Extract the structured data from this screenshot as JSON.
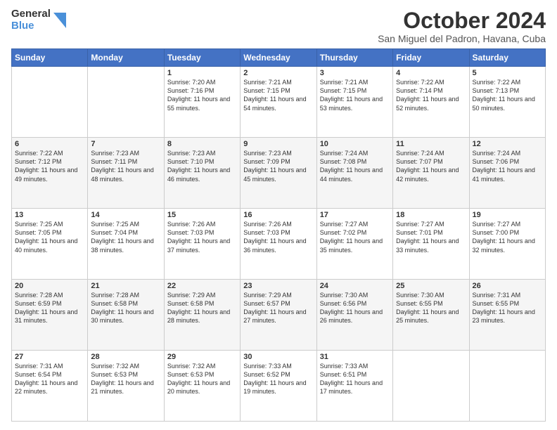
{
  "logo": {
    "line1": "General",
    "line2": "Blue"
  },
  "title": "October 2024",
  "location": "San Miguel del Padron, Havana, Cuba",
  "days_of_week": [
    "Sunday",
    "Monday",
    "Tuesday",
    "Wednesday",
    "Thursday",
    "Friday",
    "Saturday"
  ],
  "weeks": [
    [
      {
        "day": "",
        "sunrise": "",
        "sunset": "",
        "daylight": ""
      },
      {
        "day": "",
        "sunrise": "",
        "sunset": "",
        "daylight": ""
      },
      {
        "day": "1",
        "sunrise": "Sunrise: 7:20 AM",
        "sunset": "Sunset: 7:16 PM",
        "daylight": "Daylight: 11 hours and 55 minutes."
      },
      {
        "day": "2",
        "sunrise": "Sunrise: 7:21 AM",
        "sunset": "Sunset: 7:15 PM",
        "daylight": "Daylight: 11 hours and 54 minutes."
      },
      {
        "day": "3",
        "sunrise": "Sunrise: 7:21 AM",
        "sunset": "Sunset: 7:15 PM",
        "daylight": "Daylight: 11 hours and 53 minutes."
      },
      {
        "day": "4",
        "sunrise": "Sunrise: 7:22 AM",
        "sunset": "Sunset: 7:14 PM",
        "daylight": "Daylight: 11 hours and 52 minutes."
      },
      {
        "day": "5",
        "sunrise": "Sunrise: 7:22 AM",
        "sunset": "Sunset: 7:13 PM",
        "daylight": "Daylight: 11 hours and 50 minutes."
      }
    ],
    [
      {
        "day": "6",
        "sunrise": "Sunrise: 7:22 AM",
        "sunset": "Sunset: 7:12 PM",
        "daylight": "Daylight: 11 hours and 49 minutes."
      },
      {
        "day": "7",
        "sunrise": "Sunrise: 7:23 AM",
        "sunset": "Sunset: 7:11 PM",
        "daylight": "Daylight: 11 hours and 48 minutes."
      },
      {
        "day": "8",
        "sunrise": "Sunrise: 7:23 AM",
        "sunset": "Sunset: 7:10 PM",
        "daylight": "Daylight: 11 hours and 46 minutes."
      },
      {
        "day": "9",
        "sunrise": "Sunrise: 7:23 AM",
        "sunset": "Sunset: 7:09 PM",
        "daylight": "Daylight: 11 hours and 45 minutes."
      },
      {
        "day": "10",
        "sunrise": "Sunrise: 7:24 AM",
        "sunset": "Sunset: 7:08 PM",
        "daylight": "Daylight: 11 hours and 44 minutes."
      },
      {
        "day": "11",
        "sunrise": "Sunrise: 7:24 AM",
        "sunset": "Sunset: 7:07 PM",
        "daylight": "Daylight: 11 hours and 42 minutes."
      },
      {
        "day": "12",
        "sunrise": "Sunrise: 7:24 AM",
        "sunset": "Sunset: 7:06 PM",
        "daylight": "Daylight: 11 hours and 41 minutes."
      }
    ],
    [
      {
        "day": "13",
        "sunrise": "Sunrise: 7:25 AM",
        "sunset": "Sunset: 7:05 PM",
        "daylight": "Daylight: 11 hours and 40 minutes."
      },
      {
        "day": "14",
        "sunrise": "Sunrise: 7:25 AM",
        "sunset": "Sunset: 7:04 PM",
        "daylight": "Daylight: 11 hours and 38 minutes."
      },
      {
        "day": "15",
        "sunrise": "Sunrise: 7:26 AM",
        "sunset": "Sunset: 7:03 PM",
        "daylight": "Daylight: 11 hours and 37 minutes."
      },
      {
        "day": "16",
        "sunrise": "Sunrise: 7:26 AM",
        "sunset": "Sunset: 7:03 PM",
        "daylight": "Daylight: 11 hours and 36 minutes."
      },
      {
        "day": "17",
        "sunrise": "Sunrise: 7:27 AM",
        "sunset": "Sunset: 7:02 PM",
        "daylight": "Daylight: 11 hours and 35 minutes."
      },
      {
        "day": "18",
        "sunrise": "Sunrise: 7:27 AM",
        "sunset": "Sunset: 7:01 PM",
        "daylight": "Daylight: 11 hours and 33 minutes."
      },
      {
        "day": "19",
        "sunrise": "Sunrise: 7:27 AM",
        "sunset": "Sunset: 7:00 PM",
        "daylight": "Daylight: 11 hours and 32 minutes."
      }
    ],
    [
      {
        "day": "20",
        "sunrise": "Sunrise: 7:28 AM",
        "sunset": "Sunset: 6:59 PM",
        "daylight": "Daylight: 11 hours and 31 minutes."
      },
      {
        "day": "21",
        "sunrise": "Sunrise: 7:28 AM",
        "sunset": "Sunset: 6:58 PM",
        "daylight": "Daylight: 11 hours and 30 minutes."
      },
      {
        "day": "22",
        "sunrise": "Sunrise: 7:29 AM",
        "sunset": "Sunset: 6:58 PM",
        "daylight": "Daylight: 11 hours and 28 minutes."
      },
      {
        "day": "23",
        "sunrise": "Sunrise: 7:29 AM",
        "sunset": "Sunset: 6:57 PM",
        "daylight": "Daylight: 11 hours and 27 minutes."
      },
      {
        "day": "24",
        "sunrise": "Sunrise: 7:30 AM",
        "sunset": "Sunset: 6:56 PM",
        "daylight": "Daylight: 11 hours and 26 minutes."
      },
      {
        "day": "25",
        "sunrise": "Sunrise: 7:30 AM",
        "sunset": "Sunset: 6:55 PM",
        "daylight": "Daylight: 11 hours and 25 minutes."
      },
      {
        "day": "26",
        "sunrise": "Sunrise: 7:31 AM",
        "sunset": "Sunset: 6:55 PM",
        "daylight": "Daylight: 11 hours and 23 minutes."
      }
    ],
    [
      {
        "day": "27",
        "sunrise": "Sunrise: 7:31 AM",
        "sunset": "Sunset: 6:54 PM",
        "daylight": "Daylight: 11 hours and 22 minutes."
      },
      {
        "day": "28",
        "sunrise": "Sunrise: 7:32 AM",
        "sunset": "Sunset: 6:53 PM",
        "daylight": "Daylight: 11 hours and 21 minutes."
      },
      {
        "day": "29",
        "sunrise": "Sunrise: 7:32 AM",
        "sunset": "Sunset: 6:53 PM",
        "daylight": "Daylight: 11 hours and 20 minutes."
      },
      {
        "day": "30",
        "sunrise": "Sunrise: 7:33 AM",
        "sunset": "Sunset: 6:52 PM",
        "daylight": "Daylight: 11 hours and 19 minutes."
      },
      {
        "day": "31",
        "sunrise": "Sunrise: 7:33 AM",
        "sunset": "Sunset: 6:51 PM",
        "daylight": "Daylight: 11 hours and 17 minutes."
      },
      {
        "day": "",
        "sunrise": "",
        "sunset": "",
        "daylight": ""
      },
      {
        "day": "",
        "sunrise": "",
        "sunset": "",
        "daylight": ""
      }
    ]
  ]
}
